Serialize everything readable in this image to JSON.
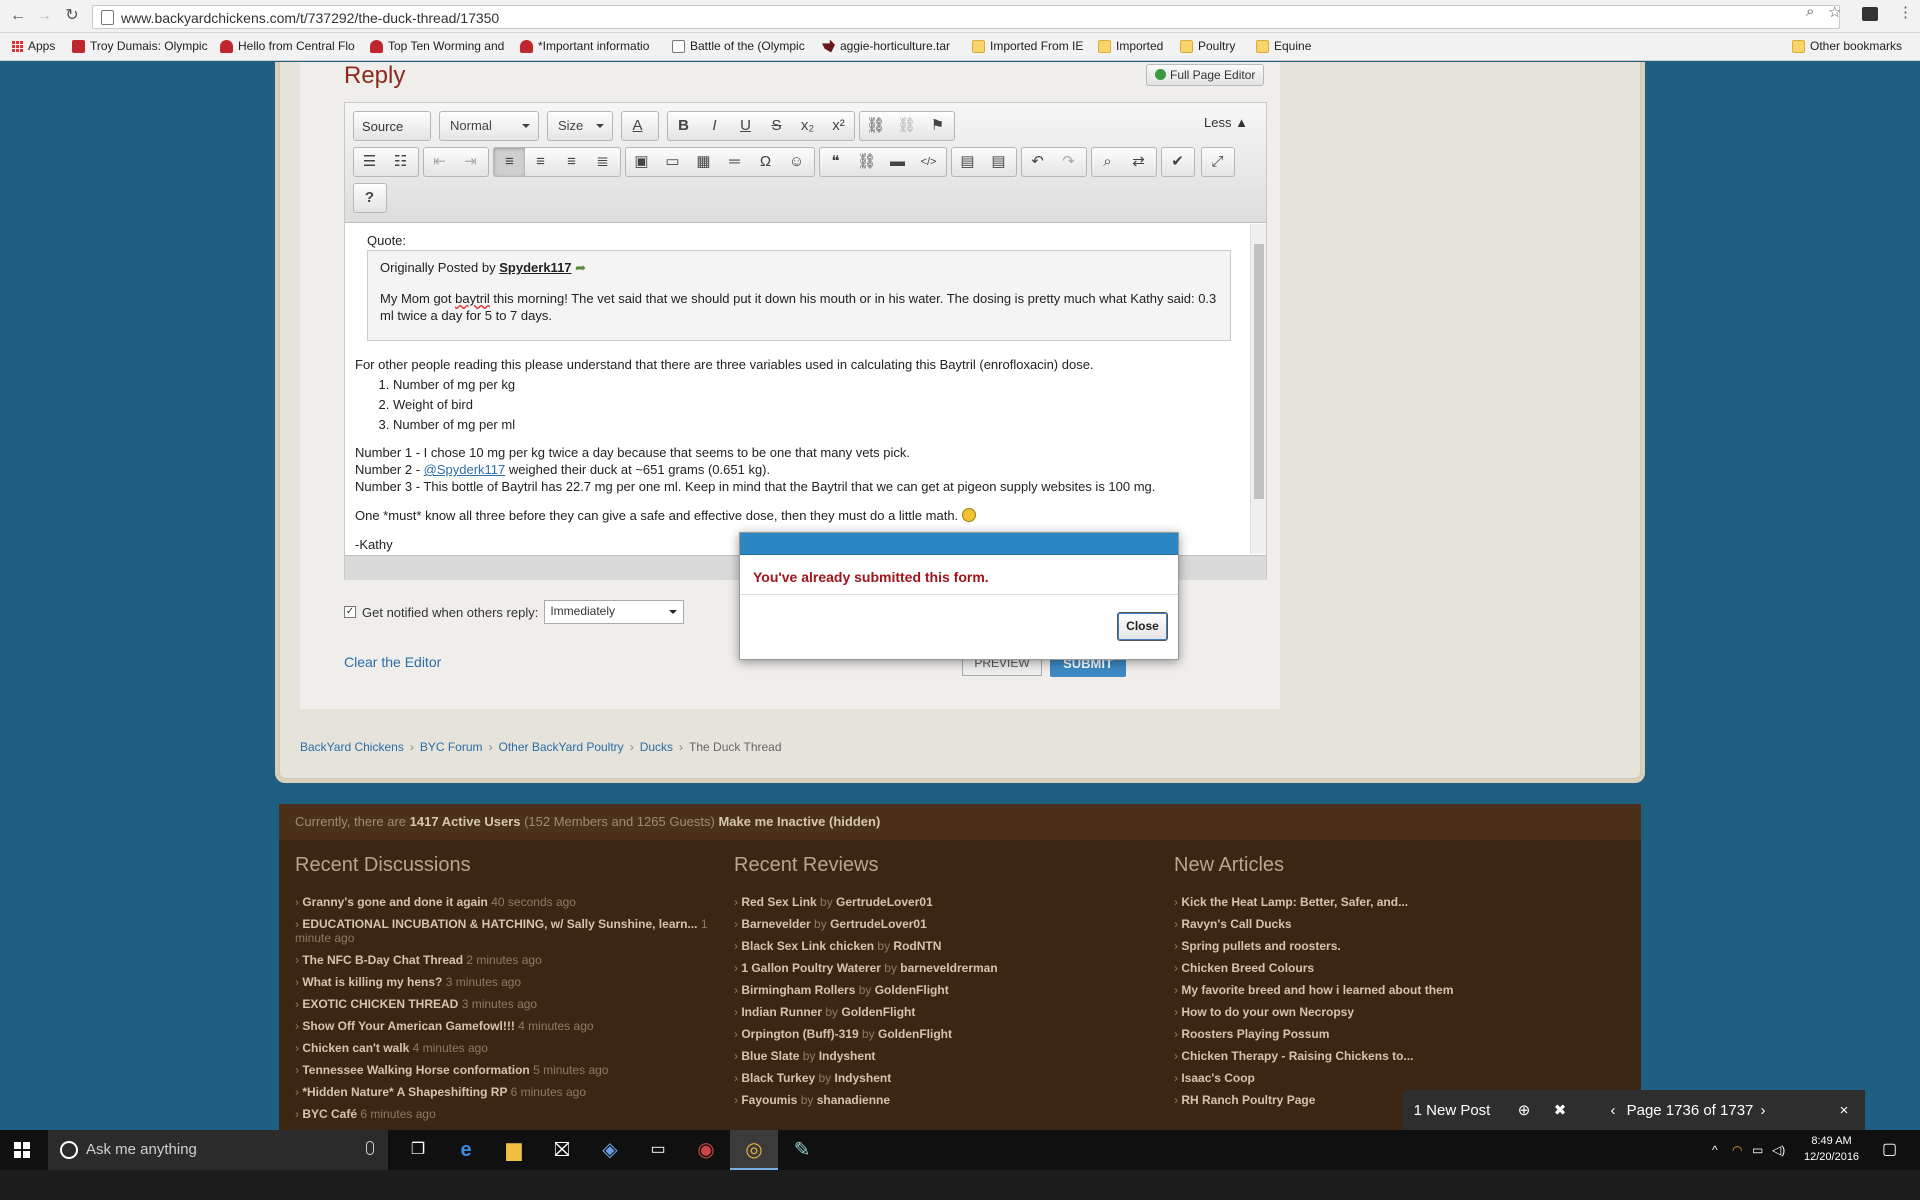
{
  "browser": {
    "url": "www.backyardchickens.com/t/737292/the-duck-thread/17350",
    "bookmarks": [
      {
        "label": "Apps",
        "icon": "apps-icon"
      },
      {
        "label": "Troy Dumais: Olympic",
        "icon": "red-f-icon"
      },
      {
        "label": "Hello from Central Flo",
        "icon": "byc-icon"
      },
      {
        "label": "Top Ten Worming and",
        "icon": "byc-icon"
      },
      {
        "label": "*Important informatio",
        "icon": "byc-icon"
      },
      {
        "label": "Battle of the (Olympic",
        "icon": "page-icon"
      },
      {
        "label": "aggie-horticulture.tar",
        "icon": "texas-icon"
      },
      {
        "label": "Imported From IE",
        "icon": "folder-icon"
      },
      {
        "label": "Imported",
        "icon": "folder-icon"
      },
      {
        "label": "Poultry",
        "icon": "folder-icon"
      },
      {
        "label": "Equine",
        "icon": "folder-icon"
      }
    ],
    "other_bookmarks": "Other bookmarks"
  },
  "reply": {
    "title": "Reply",
    "full_page_editor": "Full Page Editor",
    "toolbar": {
      "source": "Source",
      "format": "Normal",
      "size": "Size",
      "less": "Less",
      "help": "?"
    },
    "quote_label": "Quote:",
    "quote_prefix": "Originally Posted by",
    "quote_author": "Spyderk117",
    "quote_text_before": "My Mom got ",
    "quote_text_word": "baytril",
    "quote_text_after": " this morning! The vet said that we should put it down his mouth or in his water.  The dosing is pretty much what Kathy said:  0.3 ml twice a day for 5 to 7 days.",
    "intro": "For other people reading this please understand that there are three variables used in calculating this Baytril (enrofloxacin) dose.",
    "variables": [
      "Number of mg per kg",
      "Weight of bird",
      "Number of mg per ml"
    ],
    "line1": "Number 1 -  I chose 10 mg per kg twice a day because that seems to be one that many vets pick.",
    "line2_before": "Number 2 - ",
    "line2_mention": "@Spyderk117",
    "line2_after": " weighed their duck at ~651 grams (0.651 kg).",
    "line3": "Number 3 - This bottle of Baytril has 22.7 mg per one ml. Keep in mind that the Baytril that we can get at pigeon supply websites is 100 mg.",
    "line4": "One *must* know all three before they can give a safe and effective dose, then they must do a little math.",
    "signature": "-Kathy",
    "notify_label": "Get notified when others reply:",
    "notify_value": "Immediately",
    "clear": "Clear the Editor",
    "preview": "PREVIEW",
    "submit": "SUBMIT"
  },
  "breadcrumb": [
    "BackYard Chickens",
    "BYC Forum",
    "Other BackYard Poultry",
    "Ducks",
    "The Duck Thread"
  ],
  "footer": {
    "active_prefix": "Currently, there are ",
    "active_count": "1417 Active Users",
    "active_detail": "  (152 Members and 1265 Guests)",
    "inactive": " Make me Inactive (hidden)",
    "recent_discussions_title": "Recent Discussions",
    "recent_discussions": [
      {
        "title": "Granny's gone and done it again",
        "time": "40 seconds ago"
      },
      {
        "title": "EDUCATIONAL INCUBATION & HATCHING, w/ Sally Sunshine, learn...",
        "time": "1 minute ago"
      },
      {
        "title": "The NFC B-Day Chat Thread",
        "time": "2 minutes ago"
      },
      {
        "title": "What is killing my hens?",
        "time": "3 minutes ago"
      },
      {
        "title": "EXOTIC CHICKEN THREAD",
        "time": "3 minutes ago"
      },
      {
        "title": "Show Off Your American Gamefowl!!!",
        "time": "4 minutes ago"
      },
      {
        "title": "Chicken can't walk",
        "time": "4 minutes ago"
      },
      {
        "title": "Tennessee Walking Horse conformation",
        "time": "5 minutes ago"
      },
      {
        "title": "*Hidden Nature* A Shapeshifting RP",
        "time": "6 minutes ago"
      },
      {
        "title": "BYC Café",
        "time": "6 minutes ago"
      }
    ],
    "recent_reviews_title": "Recent Reviews",
    "recent_reviews": [
      {
        "title": "Red Sex Link",
        "by": "GertrudeLover01"
      },
      {
        "title": "Barnevelder",
        "by": "GertrudeLover01"
      },
      {
        "title": "Black Sex Link chicken",
        "by": "RodNTN"
      },
      {
        "title": "1 Gallon Poultry Waterer",
        "by": "barneveldrerman"
      },
      {
        "title": "Birmingham Rollers",
        "by": "GoldenFlight"
      },
      {
        "title": "Indian Runner",
        "by": "GoldenFlight"
      },
      {
        "title": "Orpington (Buff)-319",
        "by": "GoldenFlight"
      },
      {
        "title": "Blue Slate",
        "by": "Indyshent"
      },
      {
        "title": "Black Turkey",
        "by": "Indyshent"
      },
      {
        "title": "Fayoumis",
        "by": "shanadienne"
      }
    ],
    "new_articles_title": "New Articles",
    "new_articles": [
      "Kick the Heat Lamp: Better, Safer, and...",
      "Ravyn's Call Ducks",
      "Spring pullets and roosters.",
      "Chicken Breed Colours",
      "My favorite breed and how i learned about them",
      "How to do your own Necropsy",
      "Roosters Playing Possum",
      "Chicken Therapy - Raising Chickens to...",
      "Isaac's Coop",
      "RH Ranch Poultry Page"
    ]
  },
  "dialog": {
    "message": "You've already submitted this form.",
    "close": "Close"
  },
  "newpost_bar": {
    "new_post": "1 New Post",
    "page": "Page 1736 of 1737"
  },
  "taskbar": {
    "search": "Ask me anything",
    "time": "8:49 AM",
    "date": "12/20/2016"
  }
}
